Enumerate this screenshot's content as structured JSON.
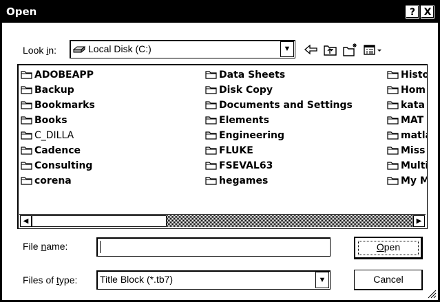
{
  "window": {
    "title": "Open",
    "help_button": "?",
    "close_button": "X"
  },
  "look_in": {
    "label_prefix": "Look ",
    "label_hotkey": "i",
    "label_suffix": "n:",
    "value": "Local Disk (C:)"
  },
  "toolbar": {
    "icons": [
      "back-icon",
      "up-folder-icon",
      "new-folder-icon",
      "view-menu-icon"
    ]
  },
  "files": {
    "columns": [
      [
        "ADOBEAPP",
        "Backup",
        "Bookmarks",
        "Books",
        "C_DILLA",
        "Cadence",
        "Consulting",
        "corena"
      ],
      [
        "Data Sheets",
        "Disk Copy",
        "Documents and Settings",
        "Elements",
        "Engineering",
        "FLUKE",
        "FSEVAL63",
        "hegames"
      ],
      [
        "Histo",
        "Hom",
        "kata",
        "MAT",
        "matla",
        "Miss",
        "Multi",
        "My M"
      ]
    ]
  },
  "file_name": {
    "label_prefix": "File ",
    "label_hotkey": "n",
    "label_suffix": "ame:",
    "value": ""
  },
  "file_type": {
    "label_prefix": "Files of ",
    "label_hotkey": "t",
    "label_suffix": "ype:",
    "value": "Title Block (*.tb7)"
  },
  "buttons": {
    "open_hotkey": "O",
    "open_rest": "pen",
    "cancel": "Cancel"
  }
}
